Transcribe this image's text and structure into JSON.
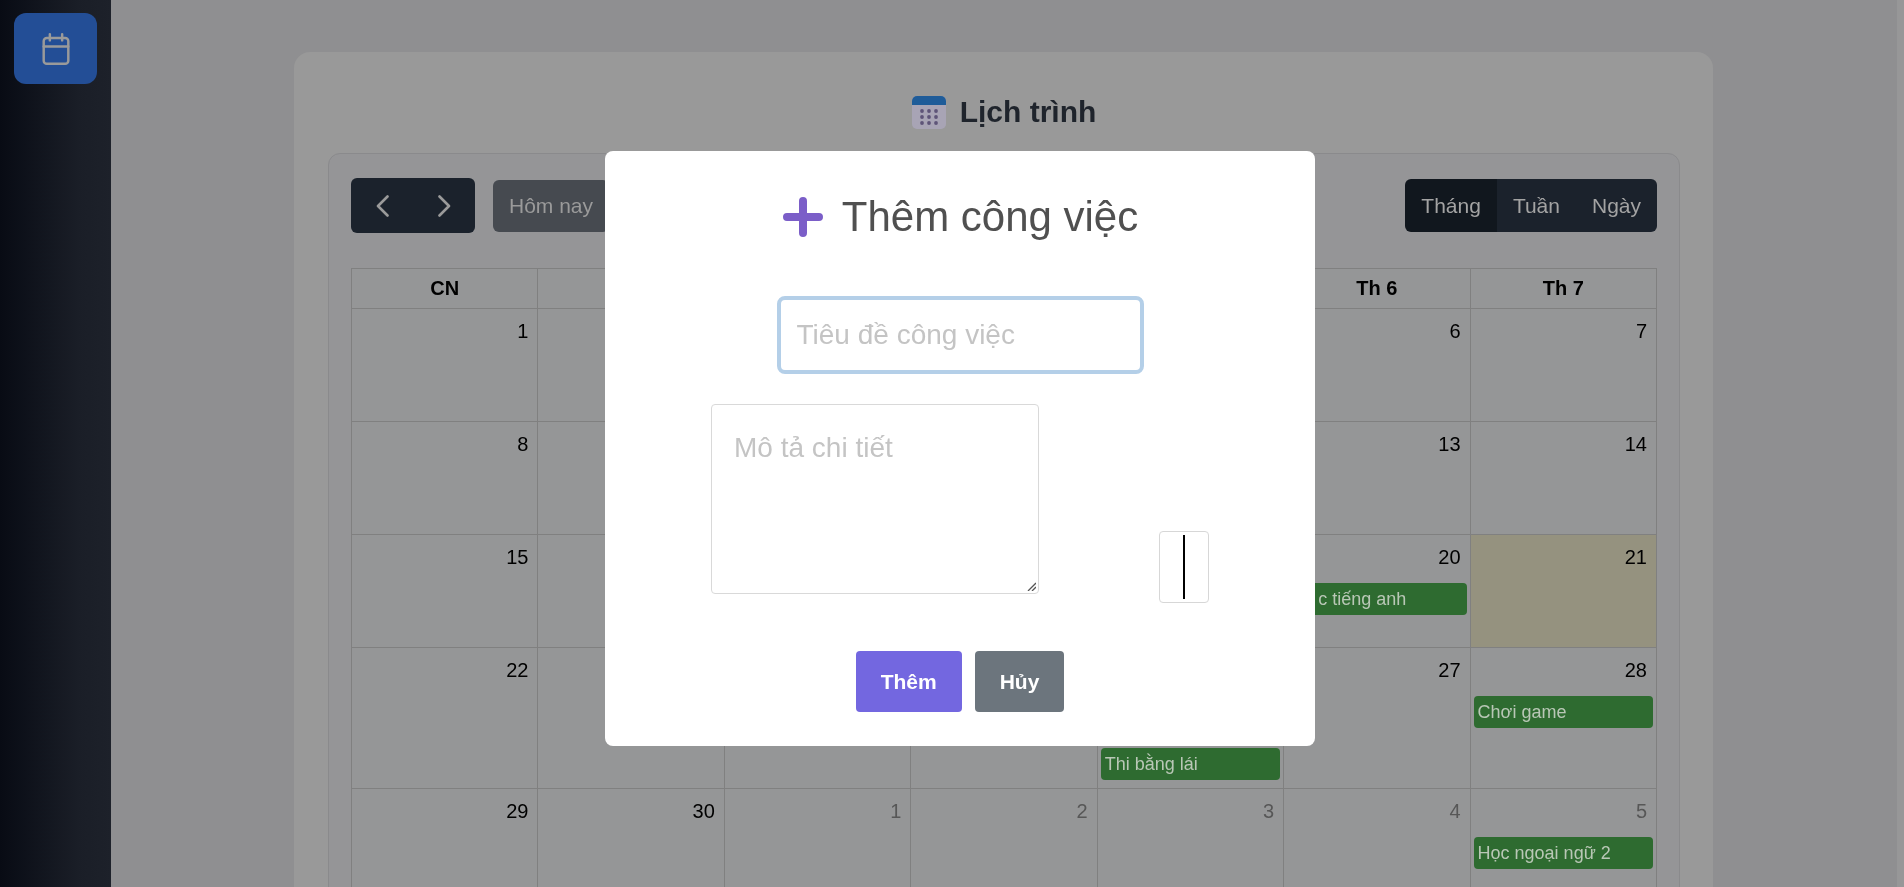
{
  "sidebar": {
    "items": [
      {
        "selected": true
      }
    ]
  },
  "page": {
    "title": "Lịch trình"
  },
  "calendar": {
    "toolbar": {
      "today_button": {
        "label": "Hôm nay",
        "disabled": true
      },
      "views": [
        {
          "label": "Tháng",
          "selected": true
        },
        {
          "label": "Tuần",
          "selected": false
        },
        {
          "label": "Ngày",
          "selected": false
        }
      ]
    },
    "weekdays": {
      "column_1": "CN",
      "column_6": "Th 6",
      "column_7": "Th 7"
    },
    "weeks": [
      {
        "column_1": {
          "date": "1",
          "today": false,
          "other_month": false
        },
        "column_2": {
          "today": false
        },
        "column_6": {
          "date": "6",
          "today": false,
          "other_month": false
        },
        "column_7": {
          "date": "7",
          "today": false,
          "other_month": false
        }
      },
      {
        "column_1": {
          "date": "8",
          "today": false,
          "other_month": false
        },
        "column_2": {
          "today": false
        },
        "column_6": {
          "date": "13",
          "today": false,
          "other_month": false
        },
        "column_7": {
          "date": "14",
          "today": false,
          "other_month": false
        }
      },
      {
        "column_1": {
          "date": "15",
          "today": false,
          "other_month": false
        },
        "column_2": {
          "today": false
        },
        "column_6": {
          "date": "20",
          "today": false,
          "other_month": false,
          "events": [
            {
              "title": "c tiếng anh"
            }
          ]
        },
        "column_7": {
          "date": "21",
          "today": true,
          "other_month": false
        }
      },
      {
        "column_1": {
          "date": "22",
          "today": false,
          "other_month": false
        },
        "column_2": {
          "today": false
        },
        "column_3": {
          "today": false
        },
        "column_4": {
          "today": false
        },
        "column_5": {
          "today": false,
          "events": [
            {
              "title": "Thi bằng lái"
            }
          ]
        },
        "column_6": {
          "date": "27",
          "today": false,
          "other_month": false
        },
        "column_7": {
          "date": "28",
          "today": false,
          "other_month": false,
          "events": [
            {
              "title": "Chơi game"
            }
          ]
        }
      },
      {
        "column_1": {
          "date": "29",
          "today": false,
          "other_month": false
        },
        "column_2": {
          "date": "30",
          "today": false,
          "other_month": false
        },
        "column_3": {
          "date": "1",
          "today": false,
          "other_month": true
        },
        "column_4": {
          "date": "2",
          "today": false,
          "other_month": true
        },
        "column_5": {
          "date": "3",
          "today": false,
          "other_month": true
        },
        "column_6": {
          "date": "4",
          "today": false,
          "other_month": true
        },
        "column_7": {
          "date": "5",
          "today": false,
          "other_month": true,
          "events": [
            {
              "title": "Học ngoại ngữ 2"
            }
          ]
        }
      }
    ]
  },
  "modal": {
    "title": "Thêm công việc",
    "title_input": {
      "placeholder": "Tiêu đề công việc",
      "focused": true
    },
    "description_input": {
      "placeholder": "Mô tả chi tiết"
    },
    "color_input": {
      "color": "#000000"
    },
    "buttons": [
      {
        "label": "Thêm",
        "kind": "primary"
      },
      {
        "label": "Hủy",
        "kind": "secondary"
      }
    ]
  }
}
